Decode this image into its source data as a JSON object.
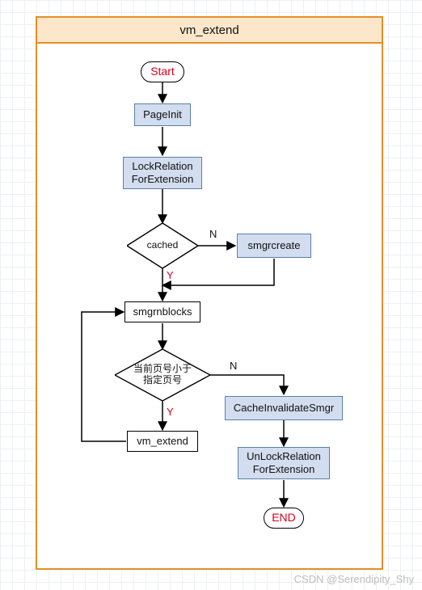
{
  "title": "vm_extend",
  "nodes": {
    "start": "Start",
    "pageinit": "PageInit",
    "lockrel": "LockRelation\nForExtension",
    "cached": "cached",
    "smgrcreate": "smgrcreate",
    "smgrnblocks": "smgrnblocks",
    "cmp": "当前页号小于\n指定页号",
    "vmextend": "vm_extend",
    "cacheinv": "CacheInvalidateSmgr",
    "unlockrel": "UnLockRelation\nForExtension",
    "end": "END"
  },
  "labels": {
    "y1": "Y",
    "n1": "N",
    "y2": "Y",
    "n2": "N"
  },
  "watermark": "CSDN @Serendipity_Shy",
  "chart_data": {
    "type": "flowchart",
    "title": "vm_extend",
    "nodes": [
      {
        "id": "start",
        "type": "terminator",
        "label": "Start"
      },
      {
        "id": "pageinit",
        "type": "process",
        "label": "PageInit"
      },
      {
        "id": "lockrel",
        "type": "process",
        "label": "LockRelationForExtension"
      },
      {
        "id": "cached",
        "type": "decision",
        "label": "cached"
      },
      {
        "id": "smgrcreate",
        "type": "process",
        "label": "smgrcreate"
      },
      {
        "id": "smgrnblocks",
        "type": "plain",
        "label": "smgrnblocks"
      },
      {
        "id": "cmp",
        "type": "decision",
        "label": "当前页号小于指定页号"
      },
      {
        "id": "vmextend",
        "type": "plain",
        "label": "vm_extend"
      },
      {
        "id": "cacheinv",
        "type": "process",
        "label": "CacheInvalidateSmgr"
      },
      {
        "id": "unlockrel",
        "type": "process",
        "label": "UnLockRelationForExtension"
      },
      {
        "id": "end",
        "type": "terminator",
        "label": "END"
      }
    ],
    "edges": [
      {
        "from": "start",
        "to": "pageinit"
      },
      {
        "from": "pageinit",
        "to": "lockrel"
      },
      {
        "from": "lockrel",
        "to": "cached"
      },
      {
        "from": "cached",
        "to": "smgrnblocks",
        "label": "Y"
      },
      {
        "from": "cached",
        "to": "smgrcreate",
        "label": "N"
      },
      {
        "from": "smgrcreate",
        "to": "smgrnblocks"
      },
      {
        "from": "smgrnblocks",
        "to": "cmp"
      },
      {
        "from": "cmp",
        "to": "vmextend",
        "label": "Y"
      },
      {
        "from": "vmextend",
        "to": "cmp",
        "note": "loop back"
      },
      {
        "from": "cmp",
        "to": "cacheinv",
        "label": "N"
      },
      {
        "from": "cacheinv",
        "to": "unlockrel"
      },
      {
        "from": "unlockrel",
        "to": "end"
      }
    ]
  }
}
